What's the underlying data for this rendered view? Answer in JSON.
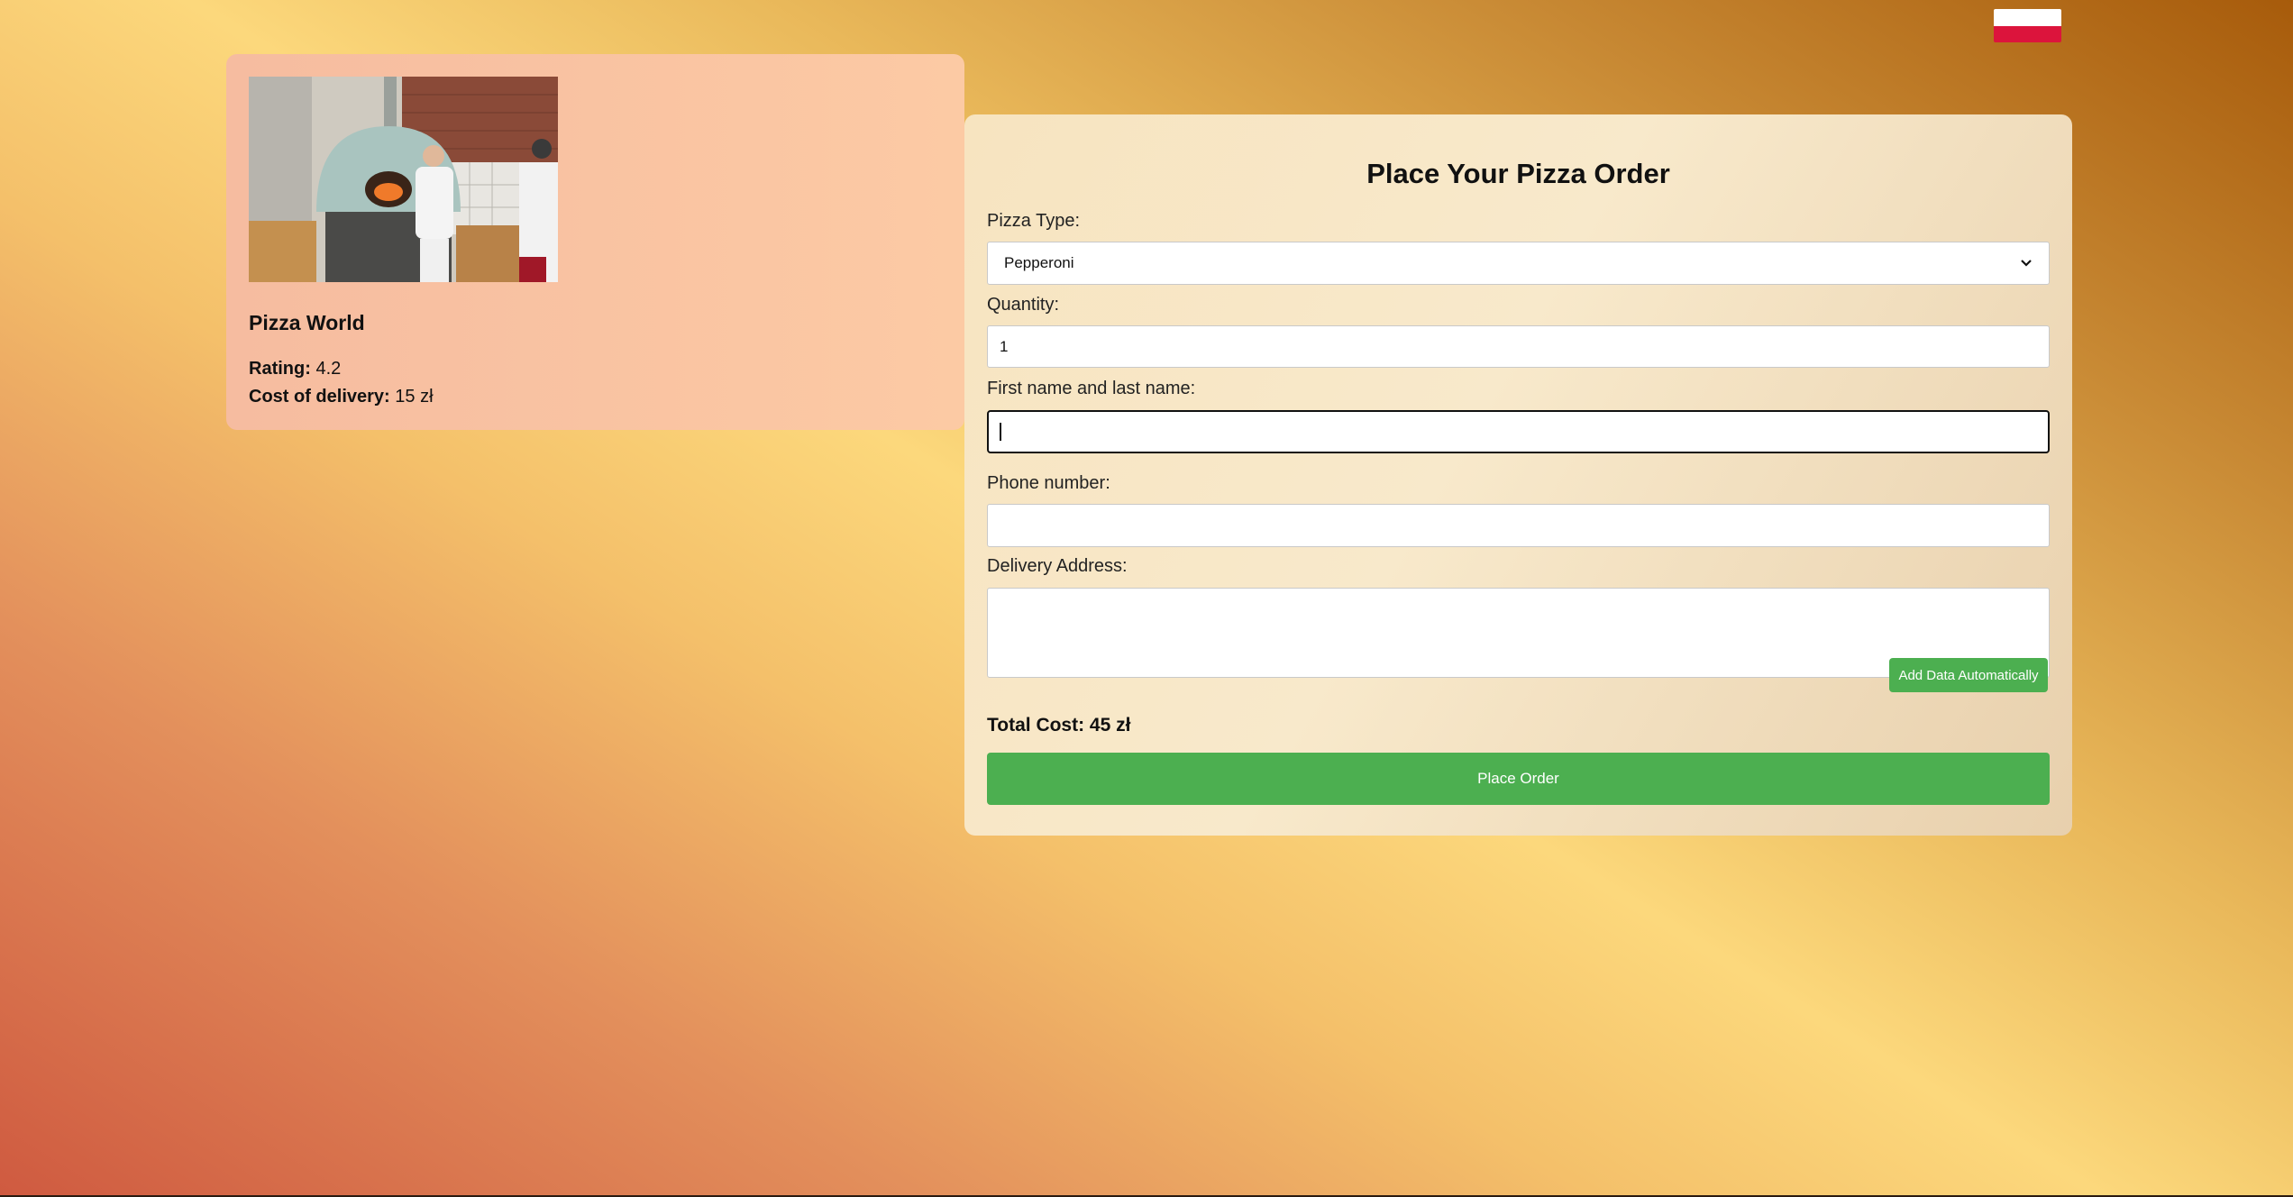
{
  "language_flag": {
    "icon": "poland-flag-icon",
    "colors": [
      "#ffffff",
      "#dc143c"
    ]
  },
  "restaurant": {
    "photo": "pizza-oven-kitchen-photo",
    "name": "Pizza World",
    "rating_label": "Rating:",
    "rating_value": "4.2",
    "delivery_label": "Cost of delivery:",
    "delivery_value": "15 zł"
  },
  "form": {
    "title": "Place Your Pizza Order",
    "pizza_type_label": "Pizza Type:",
    "pizza_type_value": "Pepperoni",
    "quantity_label": "Quantity:",
    "quantity_value": "1",
    "name_label": "First name and last name:",
    "name_value": "",
    "phone_label": "Phone number:",
    "phone_value": "",
    "address_label": "Delivery Address:",
    "address_value": "",
    "auto_fill_label": "Add Data Automatically",
    "total_label": "Total Cost: 45 zł",
    "submit_label": "Place Order"
  },
  "colors": {
    "accent": "#4caf50"
  }
}
